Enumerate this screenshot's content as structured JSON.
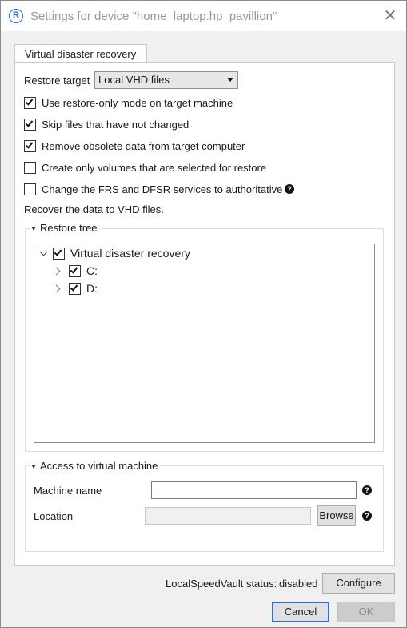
{
  "window": {
    "title": "Settings for device \"home_laptop.hp_pavillion\"",
    "app_icon_glyph": "R",
    "close_glyph": "✕"
  },
  "tabs": [
    {
      "label": "Virtual disaster recovery",
      "active": true
    }
  ],
  "restore_target": {
    "label": "Restore target",
    "selected": "Local VHD files"
  },
  "options": [
    {
      "label": "Use restore-only mode on target machine",
      "checked": true
    },
    {
      "label": "Skip files that have not changed",
      "checked": true
    },
    {
      "label": "Remove obsolete data from target computer",
      "checked": true
    },
    {
      "label": "Create only volumes that are selected for restore",
      "checked": false
    },
    {
      "label": "Change the FRS and DFSR services to authoritative",
      "checked": false,
      "has_help": true
    }
  ],
  "description": "Recover the data to VHD files.",
  "restore_tree": {
    "legend": "Restore tree",
    "root": {
      "label": "Virtual disaster recovery",
      "checked": true,
      "expanded": true
    },
    "children": [
      {
        "label": "C:",
        "checked": true,
        "expanded": false
      },
      {
        "label": "D:",
        "checked": true,
        "expanded": false
      }
    ]
  },
  "virtual_machine": {
    "legend": "Access to virtual machine",
    "machine_name_label": "Machine name",
    "machine_name_value": "",
    "location_label": "Location",
    "location_value": "",
    "browse_label": "Browse"
  },
  "footer": {
    "lsv_status_label": "LocalSpeedVault status:",
    "lsv_status_value": "disabled",
    "configure_label": "Configure",
    "cancel_label": "Cancel",
    "ok_label": "OK"
  },
  "icons": {
    "help": "?"
  },
  "colors": {
    "accent": "#2b6bd6",
    "default_button_border": "#2f6fd1"
  }
}
